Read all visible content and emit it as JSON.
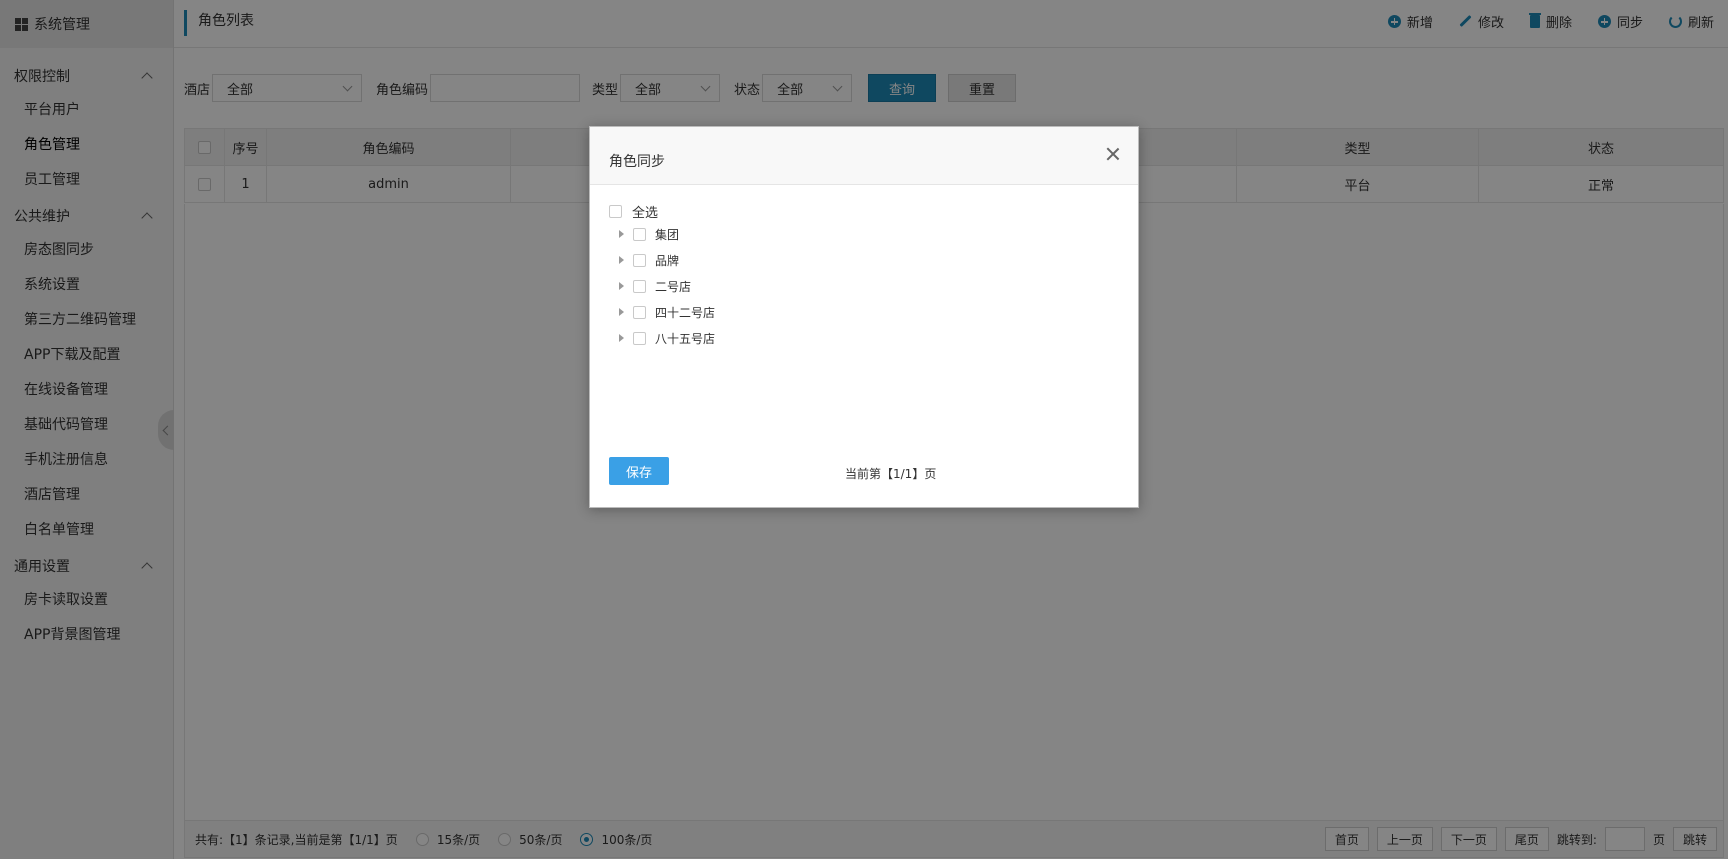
{
  "sidebar": {
    "header": "系统管理",
    "groups": [
      {
        "label": "权限控制",
        "items": [
          "平台用户",
          "角色管理",
          "员工管理"
        ]
      },
      {
        "label": "公共维护",
        "items": [
          "房态图同步",
          "系统设置",
          "第三方二维码管理",
          "APP下载及配置",
          "在线设备管理",
          "基础代码管理",
          "手机注册信息",
          "酒店管理",
          "白名单管理"
        ]
      },
      {
        "label": "通用设置",
        "items": [
          "房卡读取设置",
          "APP背景图管理"
        ]
      }
    ]
  },
  "header": {
    "title": "角色列表",
    "toolbar": {
      "add": "新增",
      "edit": "修改",
      "delete": "删除",
      "sync": "同步",
      "refresh": "刷新"
    }
  },
  "filter": {
    "hotel_label": "酒店",
    "hotel_value": "全部",
    "code_label": "角色编码",
    "code_value": "",
    "type_label": "类型",
    "type_value": "全部",
    "status_label": "状态",
    "status_value": "全部",
    "query": "查询",
    "reset": "重置"
  },
  "table": {
    "headers": {
      "index": "序号",
      "code": "角色编码",
      "type": "类型",
      "status": "状态"
    },
    "rows": [
      {
        "index": "1",
        "code": "admin",
        "type": "平台",
        "status": "正常"
      }
    ]
  },
  "pager": {
    "summary": "共有:【1】条记录,当前是第【1/1】页",
    "size15": "15条/页",
    "size50": "50条/页",
    "size100": "100条/页",
    "first": "首页",
    "prev": "上一页",
    "next": "下一页",
    "last": "尾页",
    "jump_label": "跳转到:",
    "page_unit": "页",
    "jump": "跳转"
  },
  "modal": {
    "title": "角色同步",
    "select_all": "全选",
    "nodes": [
      "集团",
      "品牌",
      "二号店",
      "四十二号店",
      "八十五号店"
    ],
    "save": "保存",
    "page_info": "当前第【1/1】页"
  },
  "colors": {
    "accent": "#1e8ab8",
    "save_button": "#3aa0e6"
  }
}
